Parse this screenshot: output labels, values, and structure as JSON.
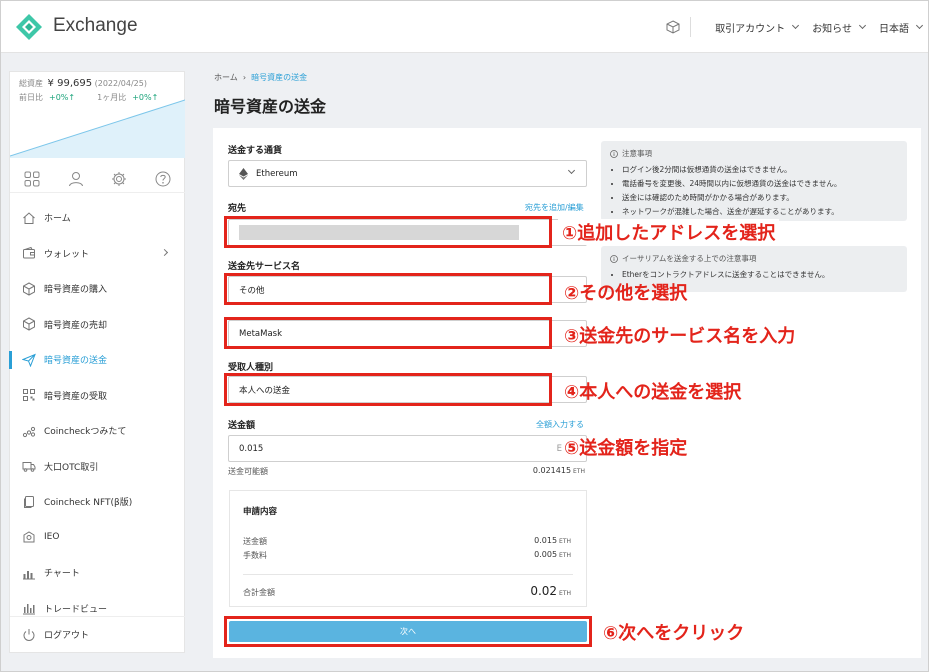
{
  "app": {
    "name": "Exchange"
  },
  "topbar": {
    "account": "取引アカウント",
    "news": "お知らせ",
    "language": "日本語"
  },
  "sidebar": {
    "total_label": "総資産",
    "total_value": "¥ 99,695",
    "total_date": "(2022/04/25)",
    "day_label": "前日比",
    "day_change": "+0%↑",
    "month_label": "1ヶ月比",
    "month_change": "+0%↑",
    "items": [
      {
        "label": "ホーム",
        "icon": "home-icon"
      },
      {
        "label": "ウォレット",
        "icon": "wallet-icon"
      },
      {
        "label": "暗号資産の購入",
        "icon": "cube-icon"
      },
      {
        "label": "暗号資産の売却",
        "icon": "cube-icon"
      },
      {
        "label": "暗号資産の送金",
        "icon": "send-icon"
      },
      {
        "label": "暗号資産の受取",
        "icon": "qr-icon"
      },
      {
        "label": "Coincheckつみたて",
        "icon": "coins-icon"
      },
      {
        "label": "大口OTC取引",
        "icon": "truck-icon"
      },
      {
        "label": "Coincheck NFT(β版)",
        "icon": "nft-icon"
      },
      {
        "label": "IEO",
        "icon": "ieo-icon"
      },
      {
        "label": "チャート",
        "icon": "chart-icon"
      },
      {
        "label": "トレードビュー",
        "icon": "tradeview-icon"
      }
    ],
    "logout": "ログアウト"
  },
  "breadcrumb": {
    "home": "ホーム",
    "current": "暗号資産の送金"
  },
  "page_title": "暗号資産の送金",
  "form": {
    "currency_label": "送金する通貨",
    "currency_value": "Ethereum",
    "address_label": "宛先",
    "address_link": "宛先を追加/編集",
    "service_label": "送金先サービス名",
    "service_value": "その他",
    "service_name_value": "MetaMask",
    "recipient_label": "受取人種別",
    "recipient_value": "本人への送金",
    "amount_label": "送金額",
    "amount_link": "全額入力する",
    "amount_value": "0.015",
    "amount_unit": "E",
    "available_label": "送金可能額",
    "available_value": "0.021415",
    "available_unit": "ETH"
  },
  "summary": {
    "title": "申請内容",
    "amount_label": "送金額",
    "amount_value": "0.015",
    "amount_unit": "ETH",
    "fee_label": "手数料",
    "fee_value": "0.005",
    "fee_unit": "ETH",
    "total_label": "合計金額",
    "total_value": "0.02",
    "total_unit": "ETH"
  },
  "next_button": "次へ",
  "notes": {
    "title": "注意事項",
    "items": [
      "ログイン後2分間は仮想通貨の送金はできません。",
      "電話番号を変更後、24時間以内に仮想通貨の送金はできません。",
      "送金には確認のため時間がかかる場合があります。",
      "ネットワークが混雑した場合、送金が遅延することがあります。"
    ],
    "eth_title": "イーサリアムを送金する上での注意事項",
    "eth_items": [
      "Etherをコントラクトアドレスに送金することはできません。"
    ]
  },
  "annotations": [
    "①追加したアドレスを選択",
    "②その他を選択",
    "③送金先のサービス名を入力",
    "④本人への送金を選択",
    "⑤送金額を指定",
    "⑥次へをクリック"
  ],
  "colors": {
    "accent": "#2a9fd6",
    "annotation": "#e3241b",
    "button": "#5ab4e0",
    "positive": "#1aa37a"
  }
}
